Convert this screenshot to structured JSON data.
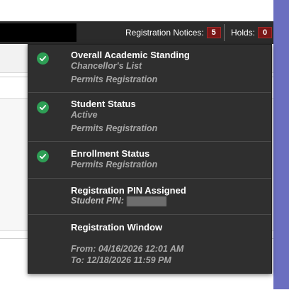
{
  "header": {
    "registration_notices_label": "Registration Notices:",
    "registration_notices_count": "5",
    "holds_label": "Holds:",
    "holds_count": "0"
  },
  "dropdown": {
    "items": [
      {
        "title": "Overall Academic Standing",
        "detail": "Chancellor's List",
        "status": "Permits Registration",
        "icon": "check-circle-icon"
      },
      {
        "title": "Student Status",
        "detail": "Active",
        "status": "Permits Registration",
        "icon": "check-circle-icon"
      },
      {
        "title": "Enrollment Status",
        "status": "Permits Registration",
        "icon": "check-circle-icon"
      },
      {
        "title": "Registration PIN Assigned",
        "pin_label": "Student PIN:"
      },
      {
        "title": "Registration Window",
        "from": "From: 04/16/2026 12:01 AM",
        "to": "To: 12/18/2026 11:59 PM"
      }
    ]
  },
  "colors": {
    "topbar": "#2b2b2b",
    "dropdown_bg": "#2f2f2f",
    "badge": "#7a1616",
    "check": "#2e9e55",
    "muted_text": "#a8a8a8"
  }
}
